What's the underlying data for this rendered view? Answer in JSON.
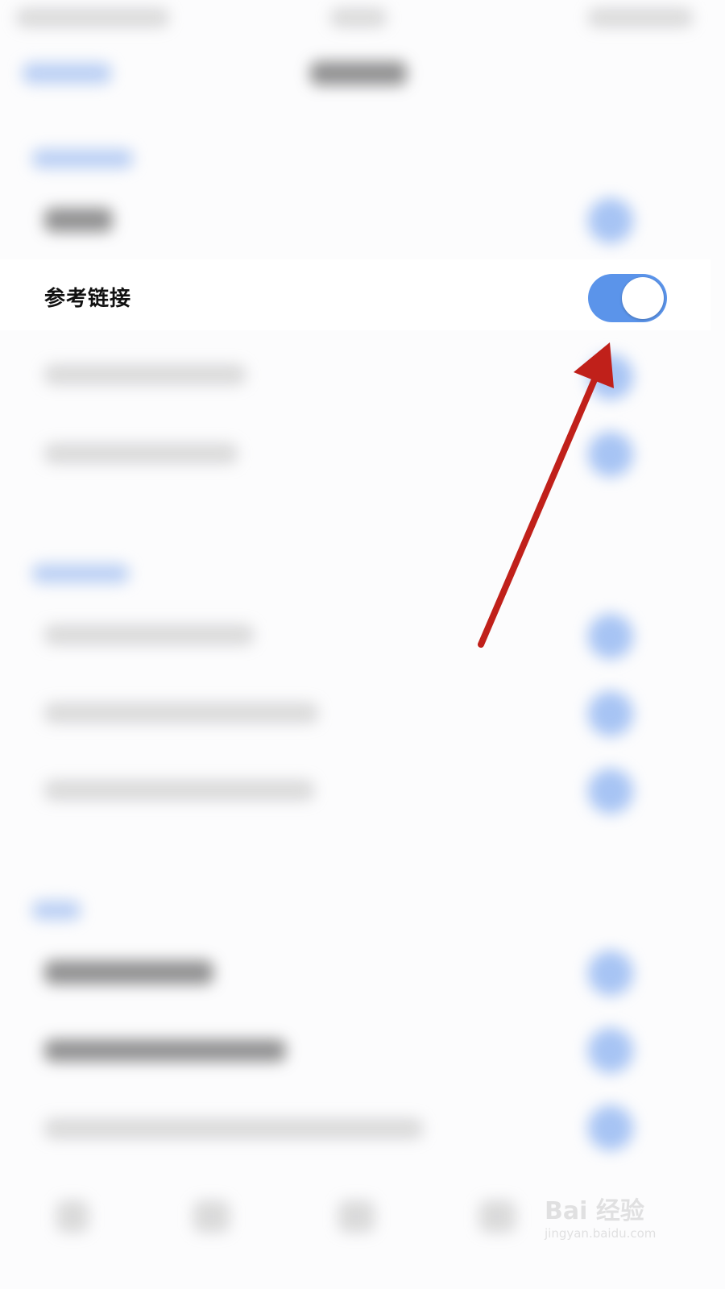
{
  "setting_row": {
    "label": "参考链接",
    "toggle_state": "on"
  },
  "watermark": {
    "brand": "Bai 经验",
    "url": "jingyan.baidu.com"
  },
  "colors": {
    "toggle_on": "#5b94ea",
    "arrow": "#c0201a"
  }
}
